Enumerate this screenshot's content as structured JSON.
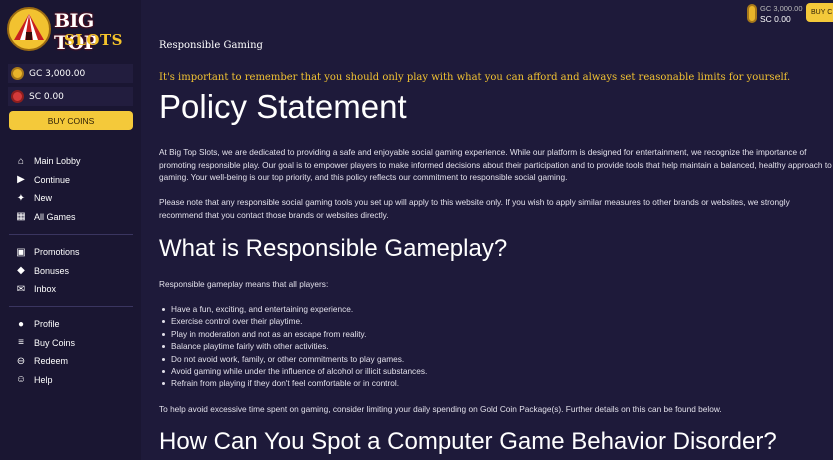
{
  "brand": {
    "line1": "BIG TOP",
    "line2": "SLOTS"
  },
  "wallet": {
    "gc": "GC 3,000.00",
    "sc": "SC 0.00",
    "buy": "BUY COINS"
  },
  "topbar": {
    "gc": "GC 3,000.00",
    "sc": "SC 0.00",
    "buy": "BUY C"
  },
  "nav": {
    "group1": [
      {
        "label": "Main Lobby",
        "icon": "home-icon",
        "glyph": "⌂"
      },
      {
        "label": "Continue",
        "icon": "play-icon",
        "glyph": "▶"
      },
      {
        "label": "New",
        "icon": "sparkle-icon",
        "glyph": "✦"
      },
      {
        "label": "All Games",
        "icon": "grid-icon",
        "glyph": "▦"
      }
    ],
    "group2": [
      {
        "label": "Promotions",
        "icon": "gift-icon",
        "glyph": "▣"
      },
      {
        "label": "Bonuses",
        "icon": "tag-icon",
        "glyph": "◆"
      },
      {
        "label": "Inbox",
        "icon": "inbox-icon",
        "glyph": "✉"
      }
    ],
    "group3": [
      {
        "label": "Profile",
        "icon": "user-icon",
        "glyph": "●"
      },
      {
        "label": "Buy Coins",
        "icon": "coins-icon",
        "glyph": "≡"
      },
      {
        "label": "Redeem",
        "icon": "redeem-icon",
        "glyph": "⊖"
      },
      {
        "label": "Help",
        "icon": "help-icon",
        "glyph": "☺"
      }
    ]
  },
  "content": {
    "breadcrumb": "Responsible Gaming",
    "highlight": "It's important to remember that you should only play with what you can afford and always set reasonable limits for yourself.",
    "title": "Policy Statement",
    "para1": "At Big Top Slots, we are dedicated to providing a safe and enjoyable social gaming experience. While our platform is designed for entertainment, we recognize the importance of promoting responsible play. Our goal is to empower players to make informed decisions about their participation and to provide tools that help maintain a balanced, healthy approach to gaming. Your well-being is our top priority, and this policy reflects our commitment to responsible social gaming.",
    "para2": "Please note that any responsible social gaming tools you set up will apply to this website only. If you wish to apply similar measures to other brands or websites, we strongly recommend that you contact those brands or websites directly.",
    "h2a": "What is Responsible Gameplay?",
    "intro": "Responsible gameplay means that all players:",
    "bullets": [
      "Have a fun, exciting, and entertaining experience.",
      "Exercise control over their playtime.",
      "Play in moderation and not as an escape from reality.",
      "Balance playtime fairly with other activities.",
      "Do not avoid work, family, or other commitments to play games.",
      "Avoid gaming while under the influence of alcohol or illicit substances.",
      "Refrain from playing if they don't feel comfortable or in control."
    ],
    "para3": "To help avoid excessive time spent on gaming, consider limiting your daily spending on Gold Coin Package(s). Further details on this can be found below.",
    "h2b": "How Can You Spot a Computer Game Behavior Disorder?"
  }
}
